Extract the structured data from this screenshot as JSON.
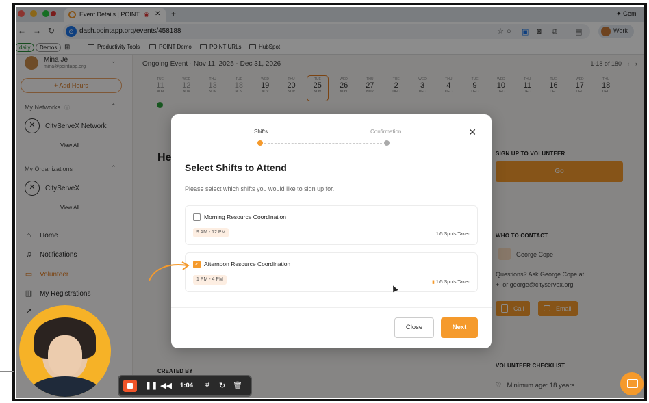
{
  "browser": {
    "tabs": [
      {
        "title": "Event Details | POINT"
      }
    ],
    "gemini_label": "Gem",
    "url": "dash.pointapp.org/events/458188",
    "profile_label": "Work",
    "bookmarks": [
      {
        "label": "daily",
        "type": "chip"
      },
      {
        "label": "Demos",
        "type": "chip"
      },
      {
        "label": "Productivity Tools",
        "type": "folder"
      },
      {
        "label": "POINT Demo",
        "type": "folder"
      },
      {
        "label": "POINT URLs",
        "type": "folder"
      },
      {
        "label": "HubSpot",
        "type": "folder"
      }
    ]
  },
  "sidebar": {
    "user_name": "Mina Je",
    "user_email": "mina@pointapp.org",
    "add_hours_label": "+ Add Hours",
    "my_networks_label": "My Networks",
    "network_name": "CityServeX Network",
    "view_all_label": "View All",
    "my_organizations_label": "My Organizations",
    "org_name": "CityServeX",
    "nav": [
      {
        "label": "Home",
        "icon": "home-icon"
      },
      {
        "label": "Notifications",
        "icon": "bell-icon"
      },
      {
        "label": "Volunteer",
        "icon": "calendar-icon"
      },
      {
        "label": "My Registrations",
        "icon": "registrations-icon"
      }
    ]
  },
  "event_header": {
    "title": "Ongoing Event · Nov 11, 2025 - Dec 31, 2026",
    "count": "1-18 of 180",
    "days": [
      {
        "num": "11",
        "mon": "NOV",
        "dow": "TUE",
        "faded": true
      },
      {
        "num": "12",
        "mon": "NOV",
        "dow": "WED",
        "faded": true
      },
      {
        "num": "13",
        "mon": "NOV",
        "dow": "THU",
        "faded": true
      },
      {
        "num": "18",
        "mon": "NOV",
        "dow": "TUE",
        "faded": true
      },
      {
        "num": "19",
        "mon": "NOV",
        "dow": "WED",
        "faded": false
      },
      {
        "num": "20",
        "mon": "NOV",
        "dow": "THU",
        "faded": false
      },
      {
        "num": "25",
        "mon": "NOV",
        "dow": "TUE",
        "faded": false,
        "selected": true
      },
      {
        "num": "26",
        "mon": "NOV",
        "dow": "WED",
        "faded": false
      },
      {
        "num": "27",
        "mon": "NOV",
        "dow": "THU",
        "faded": false
      },
      {
        "num": "2",
        "mon": "DEC",
        "dow": "TUE",
        "faded": false
      },
      {
        "num": "3",
        "mon": "DEC",
        "dow": "WED",
        "faded": false
      },
      {
        "num": "4",
        "mon": "DEC",
        "dow": "THU",
        "faded": false
      },
      {
        "num": "9",
        "mon": "DEC",
        "dow": "TUE",
        "faded": false
      },
      {
        "num": "10",
        "mon": "DEC",
        "dow": "WED",
        "faded": false
      },
      {
        "num": "11",
        "mon": "DEC",
        "dow": "THU",
        "faded": false
      },
      {
        "num": "16",
        "mon": "DEC",
        "dow": "TUE",
        "faded": false
      },
      {
        "num": "17",
        "mon": "DEC",
        "dow": "WED",
        "faded": false
      },
      {
        "num": "18",
        "mon": "DEC",
        "dow": "THU",
        "faded": false
      }
    ]
  },
  "main": {
    "heading_fragment": "He",
    "created_by_label": "CREATED BY"
  },
  "right_panel": {
    "sign_up_heading": "SIGN UP TO VOLUNTEER",
    "go_label": "Go",
    "who_heading": "WHO TO CONTACT",
    "contact_name": "George Cope",
    "questions_line1": "Questions? Ask George Cope at",
    "questions_line2": "+, or george@cityservex.org",
    "call_label": "Call",
    "email_label": "Email",
    "checklist_heading": "VOLUNTEER CHECKLIST",
    "checklist_item": "Minimum age: 18 years"
  },
  "modal": {
    "step1": "Shifts",
    "step2": "Confirmation",
    "title": "Select Shifts to Attend",
    "subtitle": "Please select which shifts you would like to sign up for.",
    "shifts": [
      {
        "name": "Morning Resource Coordination",
        "time": "9 AM - 12 PM",
        "spots": "1/5 Spots Taken",
        "checked": false
      },
      {
        "name": "Afternoon Resource Coordination",
        "time": "1 PM - 4 PM",
        "spots": "1/5 Spots Taken",
        "checked": true
      }
    ],
    "close_label": "Close",
    "next_label": "Next"
  },
  "recorder": {
    "time": "1:04"
  },
  "colors": {
    "accent": "#f59a2c",
    "selected_day_border": "#e07a20",
    "success": "#2a9d3a"
  }
}
